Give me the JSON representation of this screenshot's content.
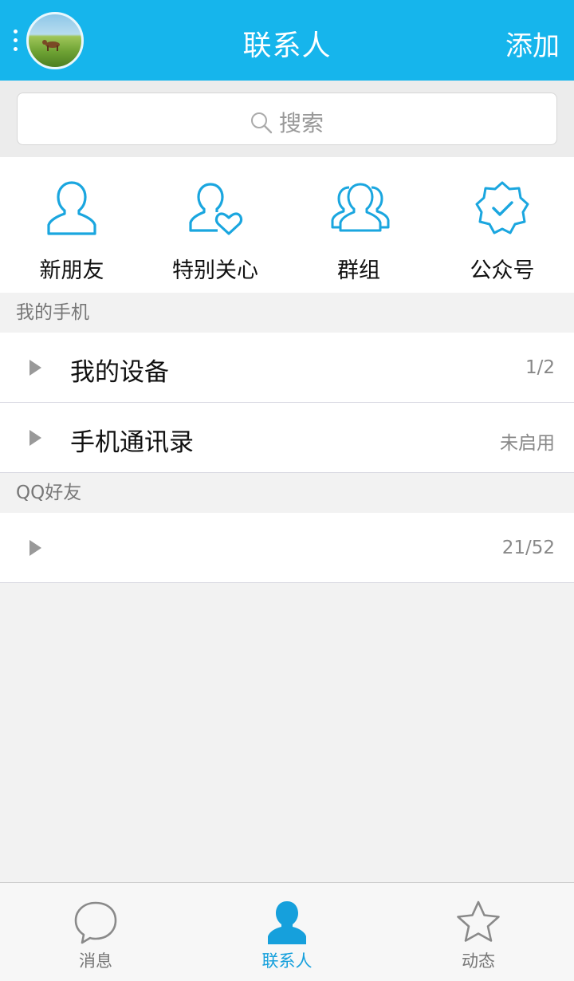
{
  "header": {
    "title": "联系人",
    "add_label": "添加",
    "accent_color": "#16b5ec"
  },
  "search": {
    "placeholder": "搜索",
    "icon": "search-icon"
  },
  "quick_entries": [
    {
      "label": "新朋友",
      "icon": "person-icon"
    },
    {
      "label": "特别关心",
      "icon": "person-heart-icon"
    },
    {
      "label": "群组",
      "icon": "group-icon"
    },
    {
      "label": "公众号",
      "icon": "verified-badge-icon"
    }
  ],
  "sections": [
    {
      "title": "我的手机",
      "rows": [
        {
          "label": "我的设备",
          "count": "1/2"
        },
        {
          "label": "手机通讯录",
          "count": "未启用"
        }
      ]
    },
    {
      "title": "QQ好友",
      "rows": [
        {
          "label": "",
          "count": "21/52"
        }
      ]
    }
  ],
  "tabbar": {
    "tabs": [
      {
        "label": "消息",
        "icon": "chat-bubble-icon",
        "active": false
      },
      {
        "label": "联系人",
        "icon": "contacts-person-icon",
        "active": true
      },
      {
        "label": "动态",
        "icon": "star-icon",
        "active": false
      }
    ]
  }
}
